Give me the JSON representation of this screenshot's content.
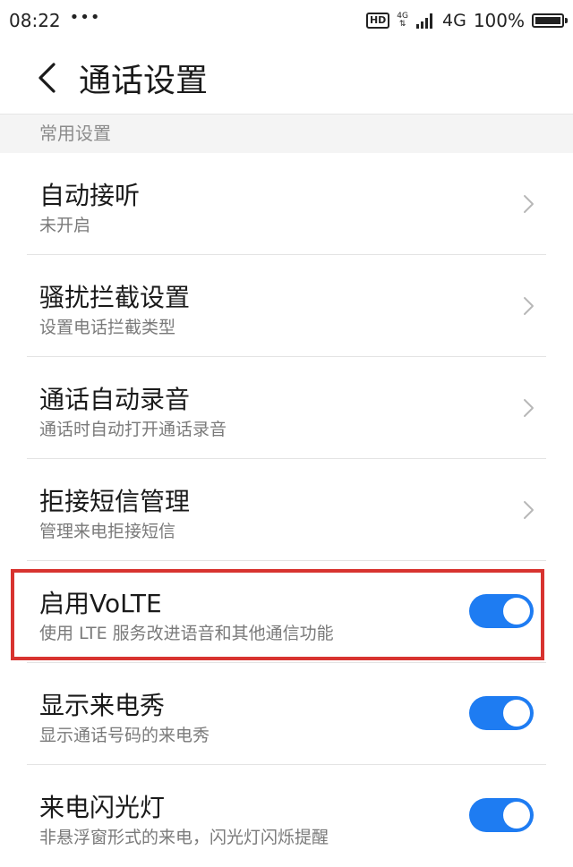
{
  "status_bar": {
    "time": "08:22",
    "dots": "•••",
    "hd": "HD",
    "network_small": "4G",
    "network": "4G",
    "battery": "100%"
  },
  "header": {
    "title": "通话设置"
  },
  "section": {
    "label": "常用设置"
  },
  "items": [
    {
      "title": "自动接听",
      "subtitle": "未开启",
      "control": "chevron"
    },
    {
      "title": "骚扰拦截设置",
      "subtitle": "设置电话拦截类型",
      "control": "chevron"
    },
    {
      "title": "通话自动录音",
      "subtitle": "通话时自动打开通话录音",
      "control": "chevron"
    },
    {
      "title": "拒接短信管理",
      "subtitle": "管理来电拒接短信",
      "control": "chevron"
    },
    {
      "title": "启用VoLTE",
      "subtitle": "使用 LTE 服务改进语音和其他通信功能",
      "control": "toggle",
      "on": true
    },
    {
      "title": "显示来电秀",
      "subtitle": "显示通话号码的来电秀",
      "control": "toggle",
      "on": true
    },
    {
      "title": "来电闪光灯",
      "subtitle": "非悬浮窗形式的来电，闪光灯闪烁提醒",
      "control": "toggle",
      "on": true
    }
  ],
  "colors": {
    "toggle_on": "#1e7cf2",
    "highlight": "#d8332f",
    "section_bg": "#f4f4f4"
  }
}
